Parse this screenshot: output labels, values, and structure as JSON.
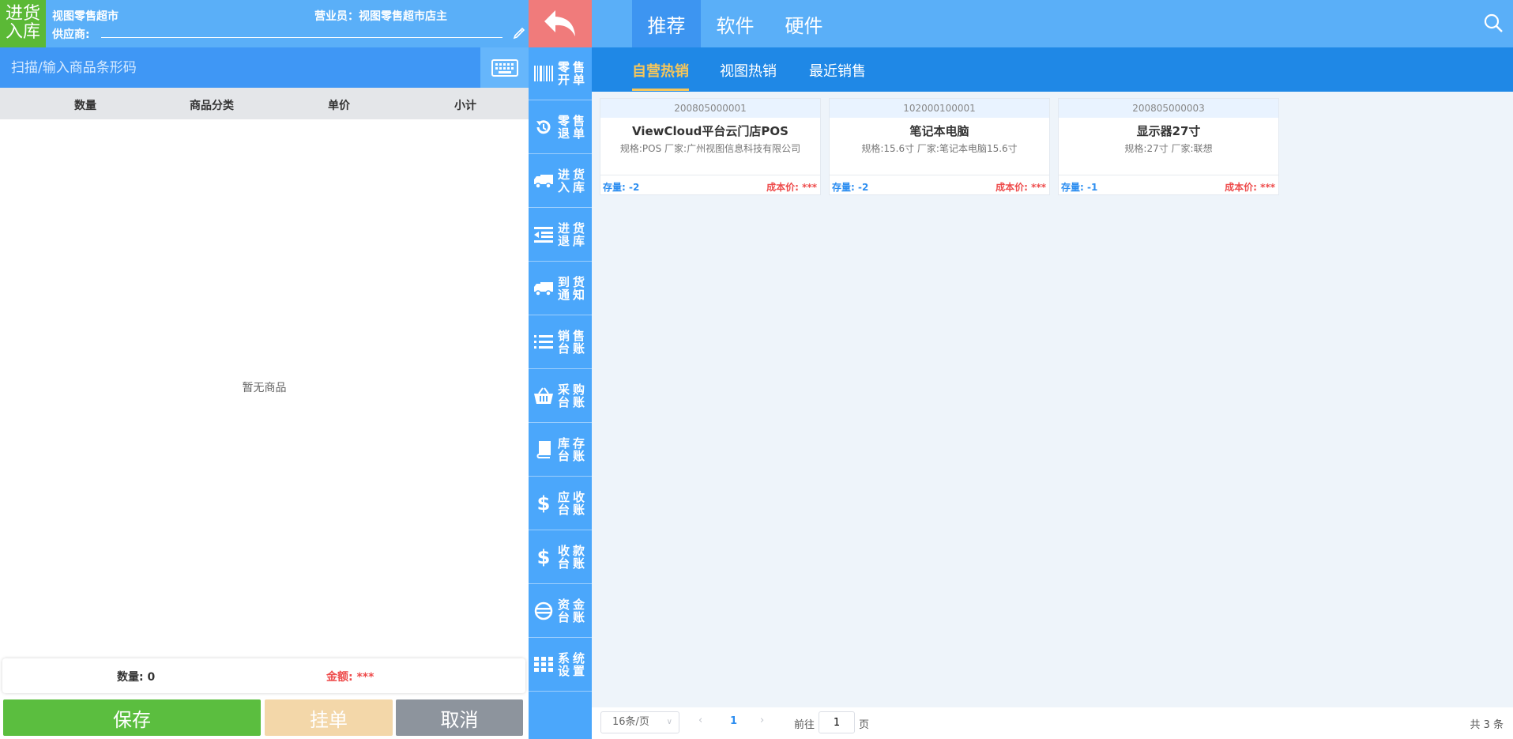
{
  "left": {
    "badge": "进货\n入库",
    "store_name": "视图零售超市",
    "staff_label": "营业员：",
    "staff_name": "视图零售超市店主",
    "supplier_label": "供应商:",
    "scan_placeholder": "扫描/输入商品条形码",
    "columns": [
      "数量",
      "商品分类",
      "单价",
      "小计"
    ],
    "empty_text": "暂无商品",
    "qty_label": "数量:",
    "qty_value": "0",
    "amount_label": "金额:",
    "amount_value": "***",
    "buttons": {
      "save": "保存",
      "hold": "挂单",
      "cancel": "取消"
    }
  },
  "menu": [
    {
      "label": "零售\n开单",
      "icon": "barcode-icon"
    },
    {
      "label": "零售\n退单",
      "icon": "return-icon"
    },
    {
      "label": "进货\n入库",
      "icon": "truck-icon"
    },
    {
      "label": "进货\n退库",
      "icon": "outdent-icon"
    },
    {
      "label": "到货\n通知",
      "icon": "truck-icon"
    },
    {
      "label": "销售\n台账",
      "icon": "list-icon"
    },
    {
      "label": "采购\n台账",
      "icon": "basket-icon"
    },
    {
      "label": "库存\n台账",
      "icon": "book-icon"
    },
    {
      "label": "应收\n台账",
      "icon": "dollar-icon"
    },
    {
      "label": "收款\n台账",
      "icon": "dollar-icon"
    },
    {
      "label": "资金\n台账",
      "icon": "coin-icon"
    },
    {
      "label": "系统\n设置",
      "icon": "grid-icon"
    }
  ],
  "right": {
    "top_tabs": [
      "推荐",
      "软件",
      "硬件"
    ],
    "sub_tabs": [
      "自营热销",
      "视图热销",
      "最近销售"
    ],
    "products": [
      {
        "code": "200805000001",
        "name": "ViewCloud平台云门店POS",
        "spec": "规格:POS 厂家:广州视图信息科技有限公司",
        "stock_label": "存量:",
        "stock": "-2",
        "cost_label": "成本价:",
        "cost": "***"
      },
      {
        "code": "102000100001",
        "name": "笔记本电脑",
        "spec": "规格:15.6寸 厂家:笔记本电脑15.6寸",
        "stock_label": "存量:",
        "stock": "-2",
        "cost_label": "成本价:",
        "cost": "***"
      },
      {
        "code": "200805000003",
        "name": "显示器27寸",
        "spec": "规格:27寸 厂家:联想",
        "stock_label": "存量:",
        "stock": "-1",
        "cost_label": "成本价:",
        "cost": "***"
      }
    ],
    "pager": {
      "page_size": "16条/页",
      "current_page": "1",
      "goto_label": "前往",
      "goto_value": "1",
      "page_word": "页",
      "total": "共 3 条"
    }
  },
  "colors": {
    "green": "#5bb936",
    "blue": "#5aaff8",
    "dark_blue": "#1f88e6",
    "red": "#ee4b4b",
    "gold": "#f6c65a",
    "salmon": "#f07b7b"
  }
}
